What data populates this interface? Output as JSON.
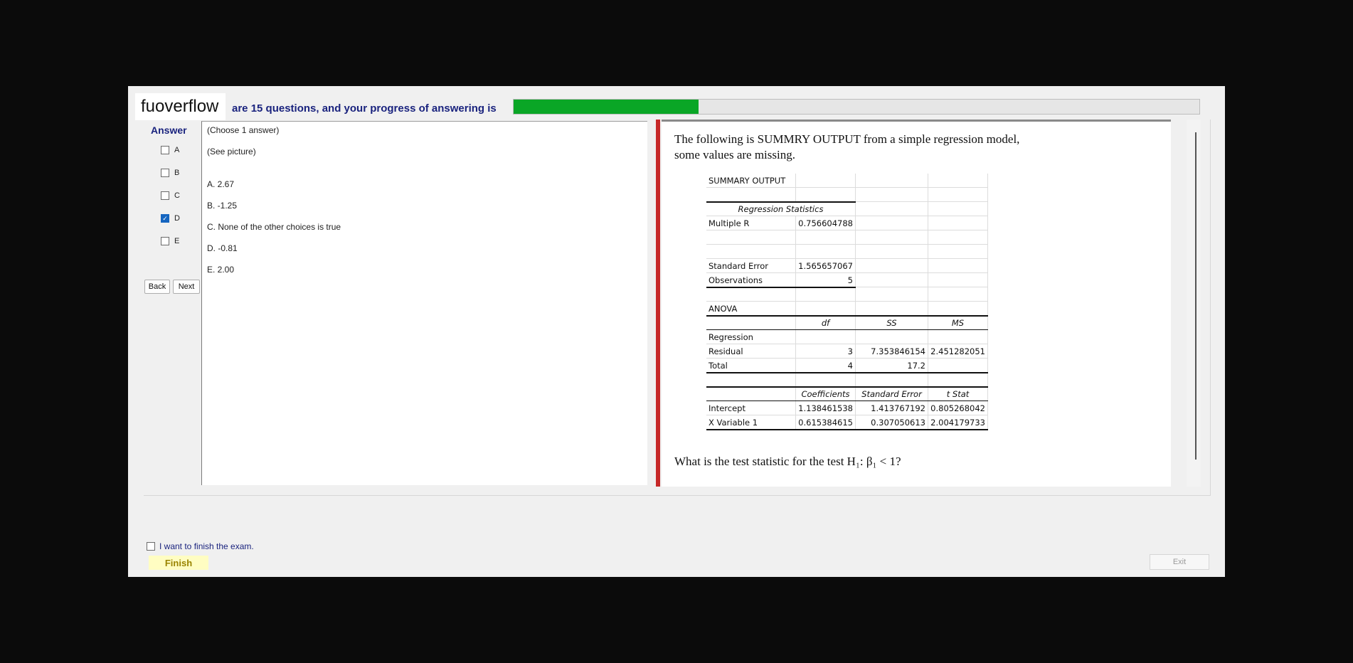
{
  "header": {
    "logo_text": "fuoverflow",
    "progress_label": "are 15 questions, and your progress of answering is",
    "progress_fraction": 0.27,
    "progress_color": "#0aa626"
  },
  "answer": {
    "heading": "Answer",
    "options": [
      {
        "label": "A",
        "checked": false
      },
      {
        "label": "B",
        "checked": false
      },
      {
        "label": "C",
        "checked": false
      },
      {
        "label": "D",
        "checked": true
      },
      {
        "label": "E",
        "checked": false
      }
    ],
    "back_label": "Back",
    "next_label": "Next"
  },
  "question": {
    "instruction": "(Choose 1 answer)",
    "prompt": "(See picture)",
    "choices": [
      "A.  2.67",
      "B.  -1.25",
      "C.  None of the other choices is true",
      "D.  -0.81",
      "E.  2.00"
    ]
  },
  "picture": {
    "intro": "The following is SUMMRY OUTPUT from a simple regression model, some values are missing.",
    "question": "What is the test statistic  for the test H₁: β₁ < 1?",
    "summary_table": {
      "title": "SUMMARY OUTPUT",
      "regression_statistics_header": "Regression Statistics",
      "multiple_r_label": "Multiple R",
      "multiple_r_value": "0.756604788",
      "standard_error_label": "Standard Error",
      "standard_error_value": "1.565657067",
      "observations_label": "Observations",
      "observations_value": "5",
      "anova_label": "ANOVA",
      "anova_headers": [
        "df",
        "SS",
        "MS"
      ],
      "anova_rows": [
        {
          "label": "Regression",
          "df": "",
          "ss": "",
          "ms": ""
        },
        {
          "label": "Residual",
          "df": "3",
          "ss": "7.353846154",
          "ms": "2.451282051"
        },
        {
          "label": "Total",
          "df": "4",
          "ss": "17.2",
          "ms": ""
        }
      ],
      "coef_headers": [
        "Coefficients",
        "Standard Error",
        "t Stat"
      ],
      "coef_rows": [
        {
          "label": "Intercept",
          "coef": "1.138461538",
          "se": "1.413767192",
          "t": "0.805268042"
        },
        {
          "label": "X Variable 1",
          "coef": "0.615384615",
          "se": "0.307050613",
          "t": "2.004179733"
        }
      ]
    }
  },
  "footer": {
    "finish_checkbox_label": "I want to finish the exam.",
    "finish_label": "Finish",
    "exit_label": "Exit"
  }
}
